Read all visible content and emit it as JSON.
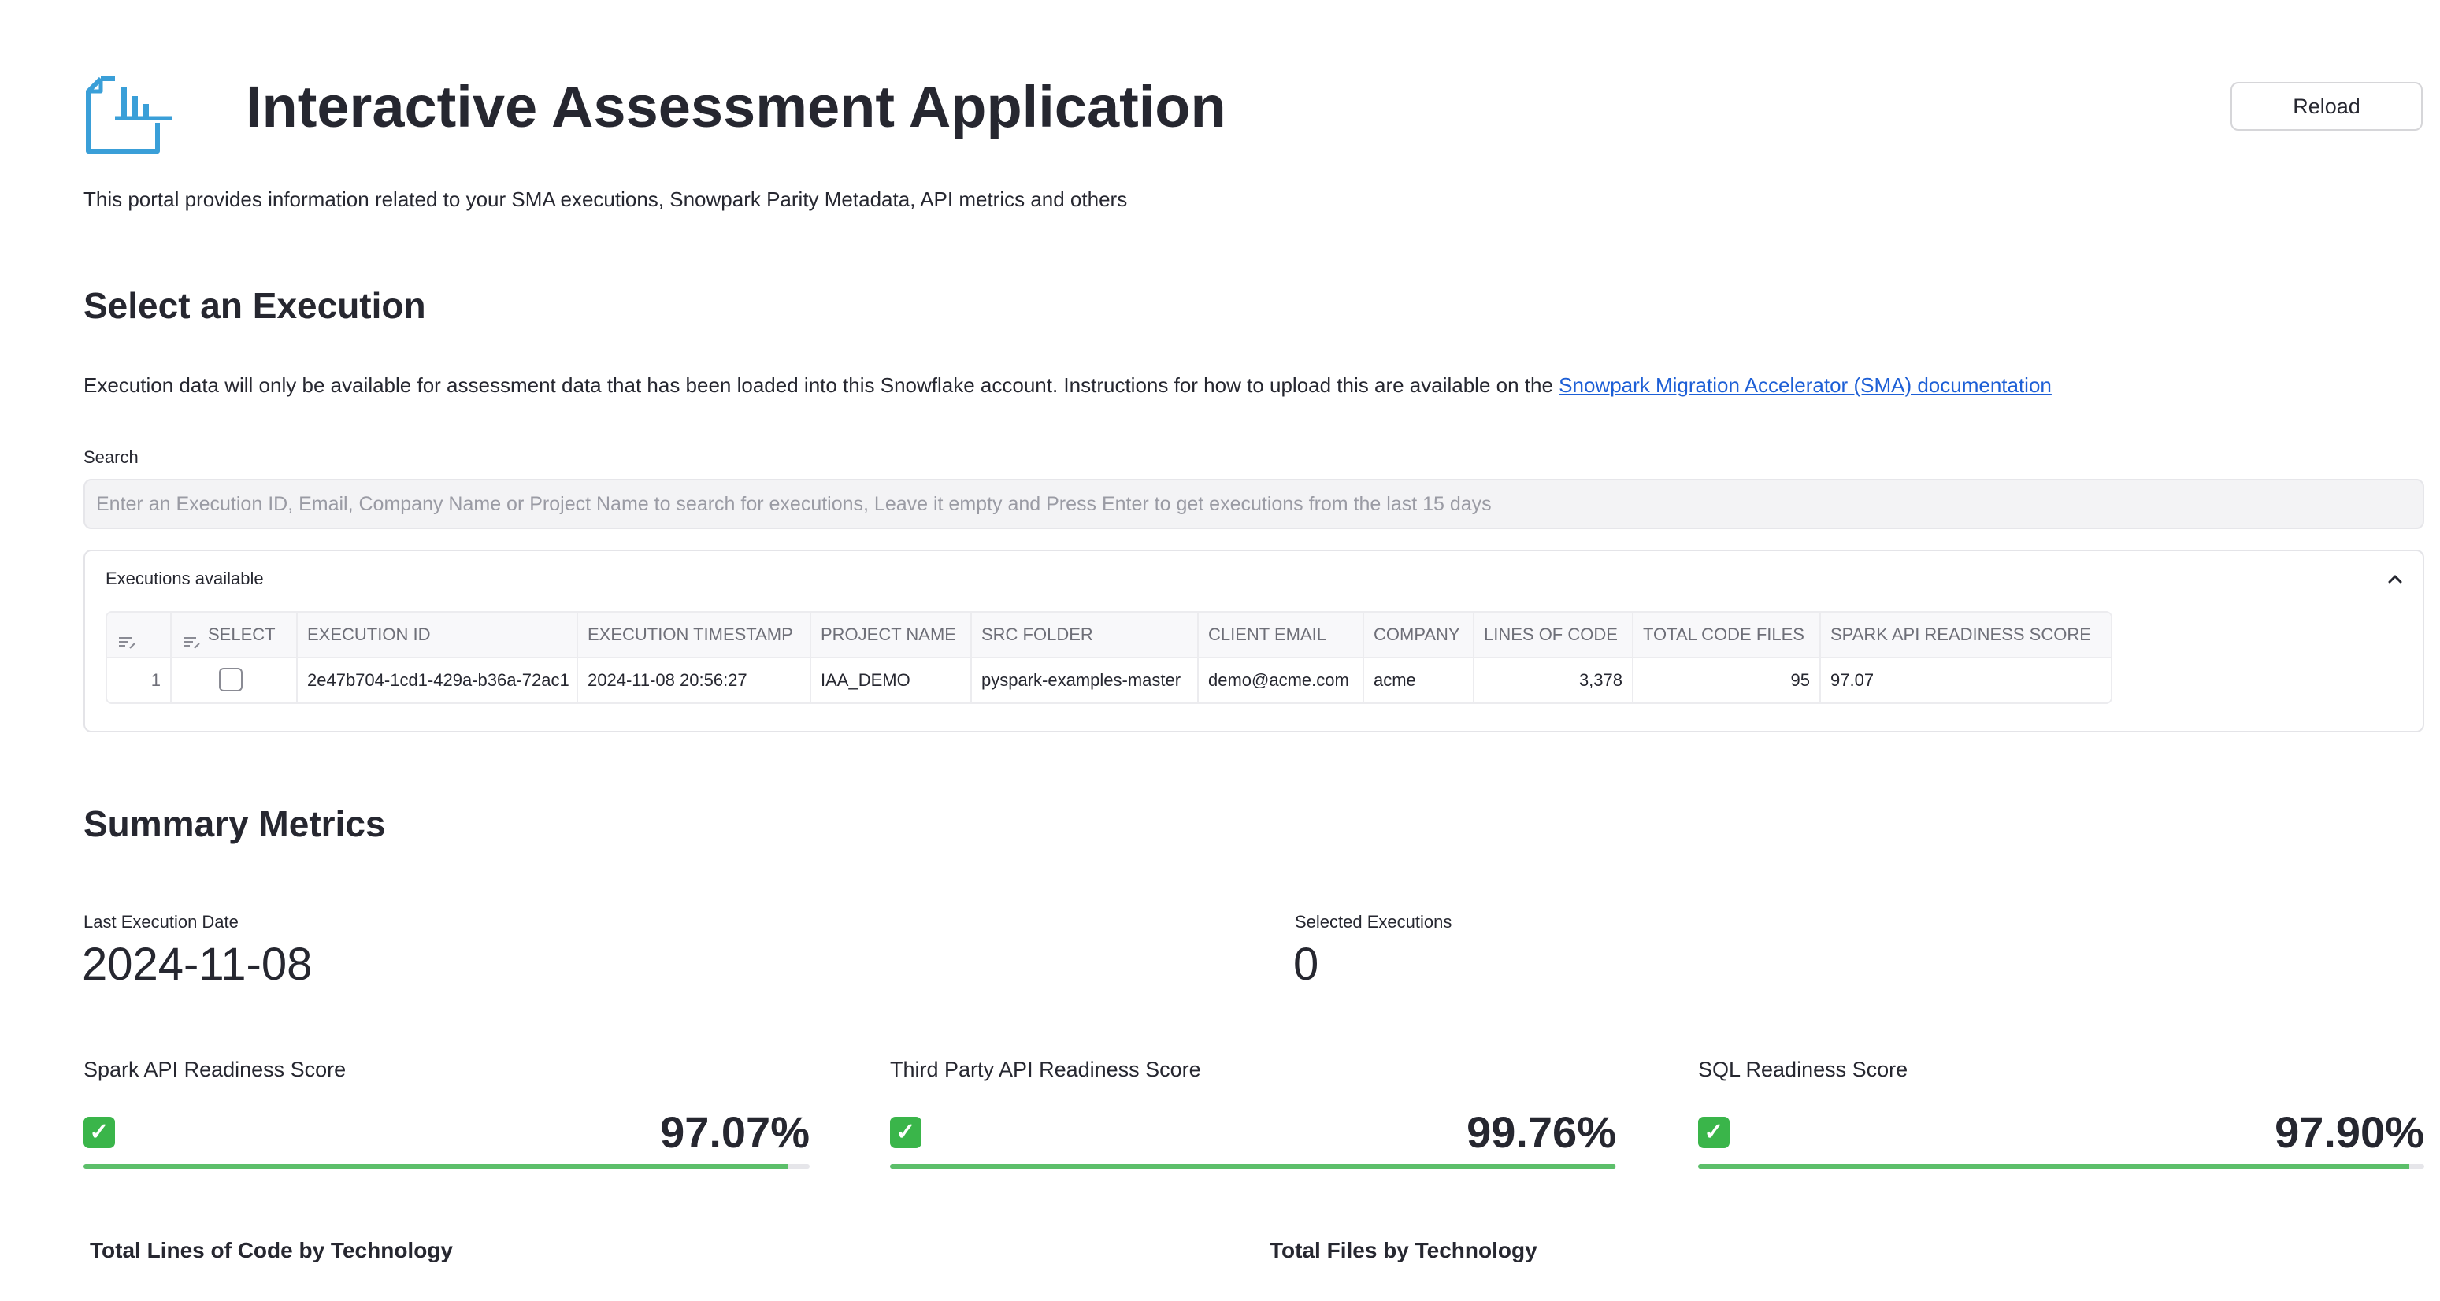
{
  "app": {
    "title": "Interactive Assessment Application",
    "reload_label": "Reload",
    "intro": "This portal provides information related to your SMA executions, Snowpark Parity Metadata, API metrics and others"
  },
  "select_section": {
    "heading": "Select an Execution",
    "description": "Execution data will only be available for assessment data that has been loaded into this Snowflake account. Instructions for how to upload this are available on the",
    "link_text": "Snowpark Migration Accelerator (SMA) documentation",
    "search_label": "Search",
    "search_value": "",
    "search_placeholder": "Enter an Execution ID, Email, Company Name or Project Name to search for executions, Leave it empty and Press Enter to get executions from the last 15 days"
  },
  "executions": {
    "title": "Executions available",
    "columns": [
      "SELECT",
      "EXECUTION ID",
      "EXECUTION TIMESTAMP",
      "PROJECT NAME",
      "SRC FOLDER",
      "CLIENT EMAIL",
      "COMPANY",
      "LINES OF CODE",
      "TOTAL CODE FILES",
      "SPARK API READINESS SCORE"
    ],
    "rows": [
      {
        "index": "1",
        "selected": false,
        "execution_id": "2e47b704-1cd1-429a-b36a-72ac1",
        "execution_timestamp": "2024-11-08 20:56:27",
        "project_name": "IAA_DEMO",
        "src_folder": "pyspark-examples-master",
        "client_email": "demo@acme.com",
        "company": "acme",
        "lines_of_code": "3,378",
        "total_code_files": "95",
        "spark_api_readiness_score": "97.07"
      }
    ]
  },
  "summary": {
    "heading": "Summary Metrics",
    "last_execution_label": "Last Execution Date",
    "last_execution_value": "2024-11-08",
    "selected_label": "Selected Executions",
    "selected_value": "0",
    "scores": [
      {
        "label": "Spark API Readiness Score",
        "value": "97.07%",
        "fraction": 0.9707
      },
      {
        "label": "Third Party API Readiness Score",
        "value": "99.76%",
        "fraction": 0.9976
      },
      {
        "label": "SQL Readiness Score",
        "value": "97.90%",
        "fraction": 0.979
      }
    ],
    "check_icon": "check-mark-icon",
    "accent_color": "#5cbf6a"
  },
  "charts": {
    "lines_title": "Total Lines of Code by Technology",
    "files_title": "Total Files by Technology"
  }
}
